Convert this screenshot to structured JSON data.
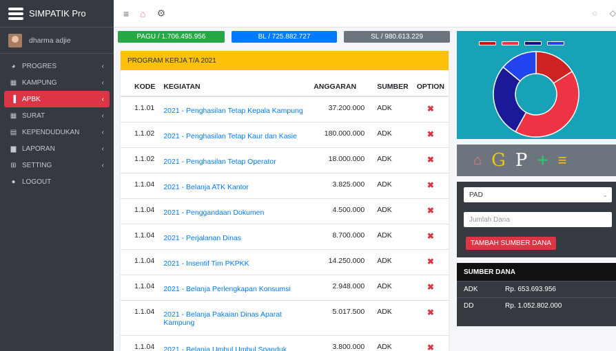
{
  "app": {
    "title": "SIMPATIK Pro"
  },
  "user": {
    "name": "dharma adjie"
  },
  "sidebar": {
    "items": [
      {
        "label": "PROGRES",
        "icon": "chart-icon",
        "glyph": "◕"
      },
      {
        "label": "KAMPUNG",
        "icon": "calendar-icon",
        "glyph": "▦"
      },
      {
        "label": "APBK",
        "icon": "chart-bar-icon",
        "glyph": "▐"
      },
      {
        "label": "SURAT",
        "icon": "grid-icon",
        "glyph": "▦"
      },
      {
        "label": "KEPENDUDUKAN",
        "icon": "table-icon",
        "glyph": "▤"
      },
      {
        "label": "LAPORAN",
        "icon": "document-icon",
        "glyph": "▆"
      },
      {
        "label": "SETTING",
        "icon": "plus-square-icon",
        "glyph": "⊞"
      },
      {
        "label": "LOGOUT",
        "icon": "circle-icon",
        "glyph": "●"
      }
    ],
    "caret": "‹",
    "active_index": 2
  },
  "topbar": {
    "menu_icon": "≡",
    "home_icon": "⌂",
    "gear_icon": "⚙",
    "chat_icon": "◌",
    "bell_icon": "◇"
  },
  "badges": {
    "pagu": "PAGU / 1.706.495.956",
    "bl": "BL / 725.882.727",
    "sl": "SL / 980.613.229"
  },
  "program": {
    "header": "PROGRAM KERJA T/A 2021",
    "columns": [
      "KODE",
      "KEGIATAN",
      "ANGGARAN",
      "SUMBER",
      "OPTION"
    ],
    "delete_icon": "✖",
    "rows": [
      {
        "kode": "1.1.01",
        "kegiatan": "2021 - Penghasilan Tetap Kepala Kampung",
        "anggaran": "37.200.000",
        "sumber": "ADK"
      },
      {
        "kode": "1.1.02",
        "kegiatan": "2021 - Penghasilan Tetap Kaur dan Kasie",
        "anggaran": "180.000.000",
        "sumber": "ADK"
      },
      {
        "kode": "1.1.02",
        "kegiatan": "2021 - Penghasilan Tetap Operator",
        "anggaran": "18.000.000",
        "sumber": "ADK"
      },
      {
        "kode": "1.1.04",
        "kegiatan": "2021 - Belanja ATK Kantor",
        "anggaran": "3.825.000",
        "sumber": "ADK"
      },
      {
        "kode": "1.1.04",
        "kegiatan": "2021 - Penggandaan Dokumen",
        "anggaran": "4.500.000",
        "sumber": "ADK"
      },
      {
        "kode": "1.1.04",
        "kegiatan": "2021 - Perjalanan Dinas",
        "anggaran": "8.700.000",
        "sumber": "ADK"
      },
      {
        "kode": "1.1.04",
        "kegiatan": "2021 - Insentif Tim PKPKK",
        "anggaran": "14.250.000",
        "sumber": "ADK"
      },
      {
        "kode": "1.1.04",
        "kegiatan": "2021 - Belanja Perlengkapan Konsumsi",
        "anggaran": "2.948.000",
        "sumber": "ADK"
      },
      {
        "kode": "1.1.04",
        "kegiatan": "2021 - Belanja Pakaian Dinas Aparat Kampung",
        "anggaran": "5.017.500",
        "sumber": "ADK"
      },
      {
        "kode": "1.1.04",
        "kegiatan": "2021 - Belanja Umbul Umbul Spanduk",
        "anggaran": "3.800.000",
        "sumber": "ADK"
      }
    ]
  },
  "chart_data": {
    "type": "pie",
    "slices": [
      {
        "color": "#cc2222",
        "value": 0.16
      },
      {
        "color": "#ee3344",
        "value": 0.42
      },
      {
        "color": "#1a1a99",
        "value": 0.28
      },
      {
        "color": "#2244ee",
        "value": 0.14
      }
    ],
    "legend_colors": [
      "#cc1111",
      "#ee3344",
      "#111188",
      "#2244ee"
    ]
  },
  "shortcuts": {
    "home": "⌂",
    "g": "G",
    "p": "P",
    "plus": "+",
    "stack": "≡"
  },
  "form": {
    "select_value": "PAD",
    "amount_placeholder": "Jumlah Dana",
    "add_button": "TAMBAH SUMBER DANA"
  },
  "sumber_dana": {
    "title": "SUMBER DANA",
    "rows": [
      {
        "k": "ADK",
        "v": "Rp. 653.693.956"
      },
      {
        "k": "DD",
        "v": "Rp. 1.052.802.000"
      }
    ]
  }
}
